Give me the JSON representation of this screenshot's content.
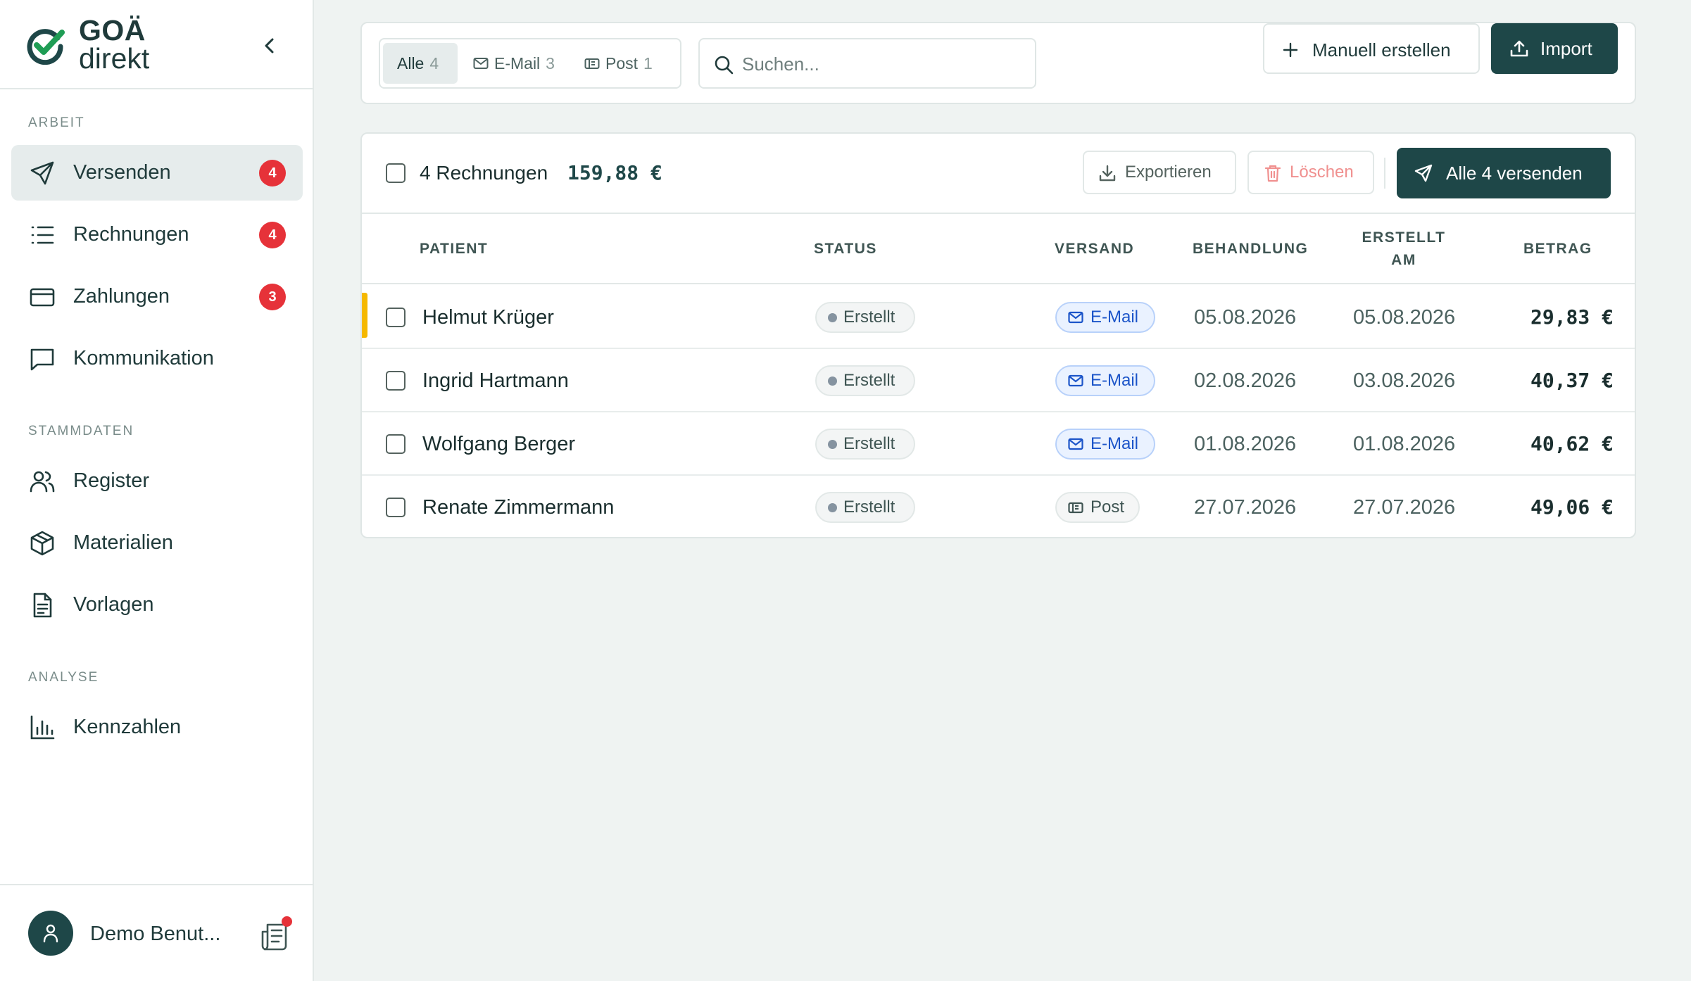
{
  "brand": {
    "line1": "GOÄ",
    "line2": "direkt",
    "accent": "#1e4748",
    "logo_green": "#1f9d55"
  },
  "sidebar": {
    "sections": [
      {
        "title": "ARBEIT",
        "items": [
          {
            "label": "Versenden",
            "icon": "send-icon",
            "badge": "4",
            "active": true
          },
          {
            "label": "Rechnungen",
            "icon": "list-icon",
            "badge": "4"
          },
          {
            "label": "Zahlungen",
            "icon": "credit-card-icon",
            "badge": "3"
          },
          {
            "label": "Kommunikation",
            "icon": "message-icon"
          }
        ]
      },
      {
        "title": "STAMMDATEN",
        "items": [
          {
            "label": "Register",
            "icon": "users-icon"
          },
          {
            "label": "Materialien",
            "icon": "package-icon"
          },
          {
            "label": "Vorlagen",
            "icon": "document-icon"
          }
        ]
      },
      {
        "title": "ANALYSE",
        "items": [
          {
            "label": "Kennzahlen",
            "icon": "bar-chart-icon"
          }
        ]
      }
    ],
    "user": {
      "name": "Demo Benut..."
    }
  },
  "toolbar": {
    "filters": [
      {
        "label": "Alle",
        "count": "4",
        "active": true
      },
      {
        "label": "E-Mail",
        "count": "3",
        "icon": "mail-icon"
      },
      {
        "label": "Post",
        "count": "1",
        "icon": "post-icon"
      }
    ],
    "search": {
      "placeholder": "Suchen..."
    },
    "manual_label": "Manuell erstellen",
    "import_label": "Import"
  },
  "table": {
    "summary": {
      "count_label": "4 Rechnungen",
      "total": "159,88 €"
    },
    "actions": {
      "export_label": "Exportieren",
      "delete_label": "Löschen",
      "send_all_label": "Alle 4 versenden"
    },
    "columns": {
      "patient": "PATIENT",
      "status": "STATUS",
      "versand": "VERSAND",
      "behandlung": "BEHANDLUNG",
      "erstellt_line1": "ERSTELLT",
      "erstellt_line2": "AM",
      "betrag": "BETRAG"
    },
    "rows": [
      {
        "patient": "Helmut Krüger",
        "status": "Erstellt",
        "versand": "E-Mail",
        "behandlung": "05.08.2026",
        "erstellt": "05.08.2026",
        "betrag": "29,83 €",
        "flagged": true
      },
      {
        "patient": "Ingrid Hartmann",
        "status": "Erstellt",
        "versand": "E-Mail",
        "behandlung": "02.08.2026",
        "erstellt": "03.08.2026",
        "betrag": "40,37 €"
      },
      {
        "patient": "Wolfgang Berger",
        "status": "Erstellt",
        "versand": "E-Mail",
        "behandlung": "01.08.2026",
        "erstellt": "01.08.2026",
        "betrag": "40,62 €"
      },
      {
        "patient": "Renate Zimmermann",
        "status": "Erstellt",
        "versand": "Post",
        "behandlung": "27.07.2026",
        "erstellt": "27.07.2026",
        "betrag": "49,06 €"
      }
    ]
  }
}
